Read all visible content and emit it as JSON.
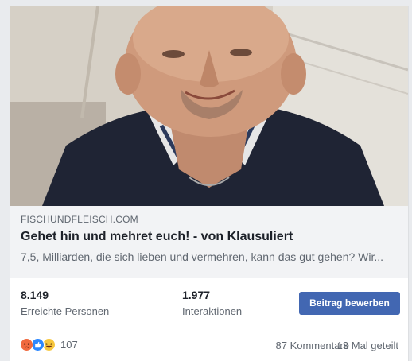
{
  "link_preview": {
    "domain": "FISCHUNDFLEISCH.COM",
    "title": "Gehet hin und mehret euch! - von Klausuliert",
    "description": "7,5, Milliarden, die sich lieben und vermehren, kann das gut gehen? Wir..."
  },
  "insights": {
    "reach_value": "8.149",
    "reach_label": "Erreichte Personen",
    "engagement_value": "1.977",
    "engagement_label": "Interaktionen"
  },
  "promote_button": {
    "label": "Beitrag bewerben",
    "color": "#4267b2"
  },
  "footer": {
    "reaction_icons": [
      "angry-reaction-icon",
      "like-reaction-icon",
      "haha-reaction-icon"
    ],
    "reaction_count": "107",
    "comments": "87 Kommentare",
    "shares": "13 Mal geteilt"
  }
}
